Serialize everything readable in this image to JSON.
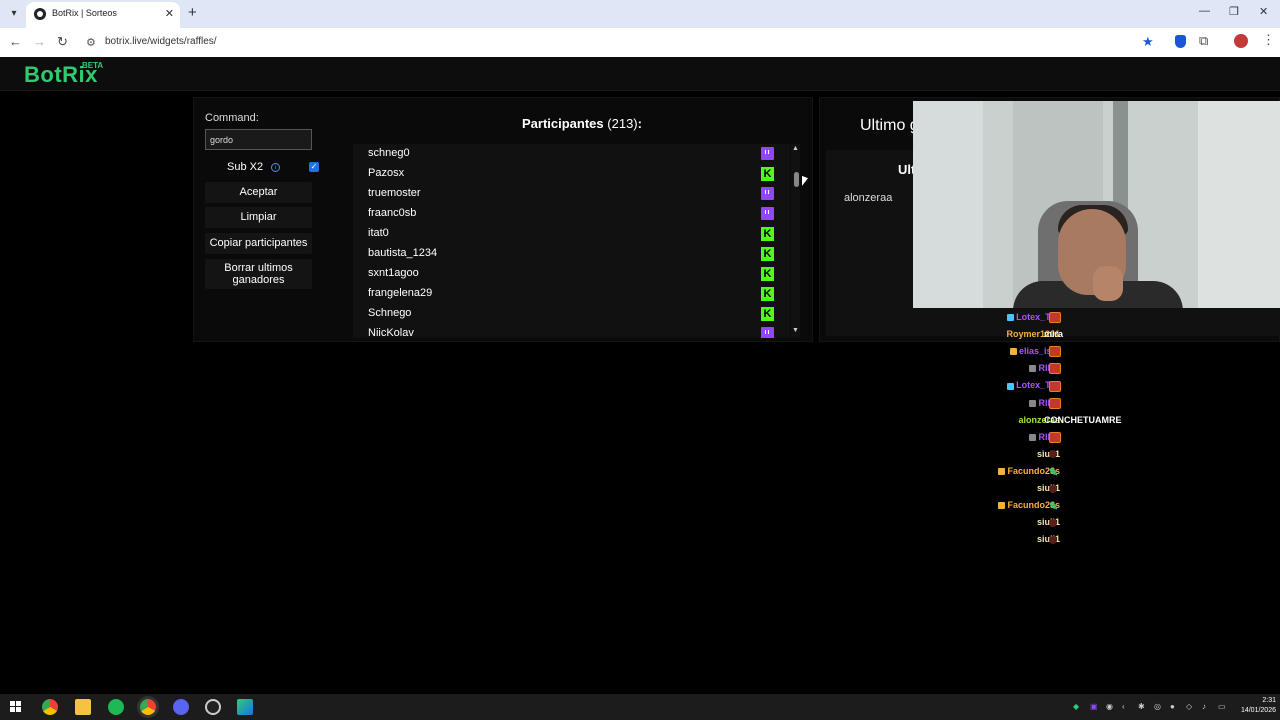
{
  "browser": {
    "tab_title": "BotRix | Sorteos",
    "tab_close": "✕",
    "new_tab": "+",
    "url": "botrix.live/widgets/raffles/",
    "window_controls": [
      "—",
      "❐",
      "✕"
    ]
  },
  "app": {
    "logo": "BotRix",
    "beta": "BETA"
  },
  "command": {
    "label": "Command:",
    "value": "gordo"
  },
  "sub": {
    "label": "Sub X2",
    "info": "i",
    "checked": true
  },
  "buttons": {
    "accept": "Aceptar",
    "clear": "Limpiar",
    "copy": "Copiar participantes",
    "delete": "Borrar ultimos ganadores"
  },
  "participants": {
    "title": "Participantes",
    "count": "(213)",
    "colon": ":",
    "rows": [
      {
        "name": "schneg0",
        "platform": "twitch"
      },
      {
        "name": "Pazosx",
        "platform": "kick"
      },
      {
        "name": "truemoster",
        "platform": "twitch"
      },
      {
        "name": "fraanc0sb",
        "platform": "twitch"
      },
      {
        "name": "itat0",
        "platform": "kick"
      },
      {
        "name": "bautista_1234",
        "platform": "kick"
      },
      {
        "name": "sxnt1agoo",
        "platform": "kick"
      },
      {
        "name": "frangelena29",
        "platform": "kick"
      },
      {
        "name": "Schnego",
        "platform": "kick"
      },
      {
        "name": "NiicKolav",
        "platform": "twitch"
      }
    ]
  },
  "last_winner": {
    "title": "Ultimo g",
    "subtitle": "Ult",
    "name": "alonzeraa"
  },
  "chat": [
    {
      "user": "Lotex_Tyk",
      "color": "#a855f7",
      "badge": "#4fc3f7",
      "text": "",
      "emote": "red"
    },
    {
      "user": "Roymer1201",
      "color": "#f5b041",
      "badge": "",
      "text": "mira",
      "emote": ""
    },
    {
      "user": "elias_isrx",
      "color": "#a855f7",
      "badge": "#f5b041",
      "text": "",
      "emote": "red"
    },
    {
      "user": "Rll10",
      "color": "#a855f7",
      "badge": "#888",
      "text": "",
      "emote": "red"
    },
    {
      "user": "Lotex_Tyk",
      "color": "#a855f7",
      "badge": "#4fc3f7",
      "text": "",
      "emote": "red"
    },
    {
      "user": "Rll10",
      "color": "#a855f7",
      "badge": "#888",
      "text": "",
      "emote": "red"
    },
    {
      "user": "alonzeraa",
      "color": "#a3e635",
      "badge": "",
      "text": "CONCHETUAMRE",
      "emote": ""
    },
    {
      "user": "Rll10",
      "color": "#a855f7",
      "badge": "#888",
      "text": "",
      "emote": "red"
    },
    {
      "user": "siuii1",
      "color": "#f5e6a8",
      "badge": "",
      "text": "",
      "emote": "small"
    },
    {
      "user": "Facundo23s",
      "color": "#f5b041",
      "badge": "#f5b041",
      "text": "",
      "emote": "green"
    },
    {
      "user": "siuii1",
      "color": "#f5e6a8",
      "badge": "",
      "text": "",
      "emote": "small"
    },
    {
      "user": "Facundo23s",
      "color": "#f5b041",
      "badge": "#f5b041",
      "text": "",
      "emote": "green"
    },
    {
      "user": "siuii1",
      "color": "#f5e6a8",
      "badge": "",
      "text": "",
      "emote": "small"
    },
    {
      "user": "siuii1",
      "color": "#f5e6a8",
      "badge": "",
      "text": "",
      "emote": "small"
    }
  ],
  "taskbar": {
    "time": "2:31",
    "date": "14/01/2026",
    "apps": [
      "windows-icon",
      "chrome-icon",
      "folder-icon",
      "spotify-icon",
      "chrome-profile-icon",
      "discord-icon",
      "obs-icon",
      "app-icon"
    ]
  },
  "colors": {
    "brand": "#2ecc71",
    "twitch": "#9146ff",
    "kick": "#53fc18"
  }
}
